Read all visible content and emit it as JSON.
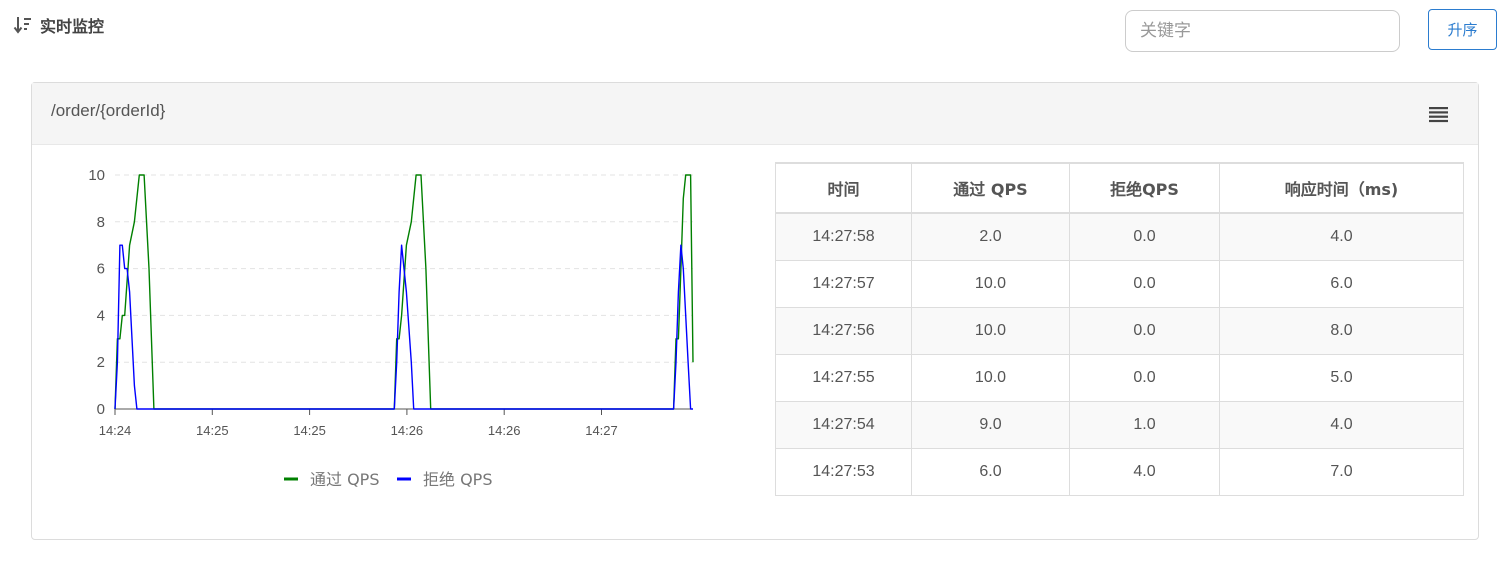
{
  "header": {
    "title": "实时监控",
    "search_placeholder": "关键字",
    "search_value": "",
    "sort_label": "升序"
  },
  "panel": {
    "resource": "/order/{orderId}",
    "menu_icon": "menu-icon"
  },
  "colors": {
    "accent": "#2b7ccf",
    "pass_series": "#008000",
    "block_series": "#0000ff"
  },
  "chart_data": {
    "type": "line",
    "title": "",
    "xlabel": "",
    "ylabel": "",
    "ylim": [
      0,
      10
    ],
    "y_ticks": [
      0,
      2,
      4,
      6,
      8,
      10
    ],
    "x_tick_labels": [
      "14:24",
      "14:25",
      "14:25",
      "14:26",
      "14:26",
      "14:27"
    ],
    "x_range": [
      "14:24:00",
      "14:27:58"
    ],
    "grid": "horizontal-dashed",
    "legend_placement": "bottom-center",
    "series": [
      {
        "name": "通过 QPS",
        "color": "#008000",
        "points": [
          [
            "14:24:00",
            0
          ],
          [
            "14:24:01",
            3
          ],
          [
            "14:24:02",
            3
          ],
          [
            "14:24:03",
            4
          ],
          [
            "14:24:04",
            4
          ],
          [
            "14:24:06",
            7
          ],
          [
            "14:24:08",
            8
          ],
          [
            "14:24:10",
            10
          ],
          [
            "14:24:12",
            10
          ],
          [
            "14:24:14",
            6
          ],
          [
            "14:24:16",
            0
          ],
          [
            "14:25:55",
            0
          ],
          [
            "14:25:56",
            3
          ],
          [
            "14:25:57",
            3
          ],
          [
            "14:25:58",
            4
          ],
          [
            "14:26:00",
            7
          ],
          [
            "14:26:02",
            8
          ],
          [
            "14:26:04",
            10
          ],
          [
            "14:26:06",
            10
          ],
          [
            "14:26:08",
            6
          ],
          [
            "14:26:10",
            0
          ],
          [
            "14:27:50",
            0
          ],
          [
            "14:27:51",
            3
          ],
          [
            "14:27:52",
            3
          ],
          [
            "14:27:53",
            6
          ],
          [
            "14:27:54",
            9
          ],
          [
            "14:27:55",
            10
          ],
          [
            "14:27:56",
            10
          ],
          [
            "14:27:57",
            10
          ],
          [
            "14:27:58",
            2
          ]
        ]
      },
      {
        "name": "拒绝 QPS",
        "color": "#0000ff",
        "points": [
          [
            "14:24:00",
            0
          ],
          [
            "14:24:01",
            2
          ],
          [
            "14:24:02",
            7
          ],
          [
            "14:24:03",
            7
          ],
          [
            "14:24:04",
            6
          ],
          [
            "14:24:05",
            6
          ],
          [
            "14:24:06",
            5
          ],
          [
            "14:24:07",
            3
          ],
          [
            "14:24:08",
            1
          ],
          [
            "14:24:09",
            0
          ],
          [
            "14:25:55",
            0
          ],
          [
            "14:25:56",
            2
          ],
          [
            "14:25:57",
            5
          ],
          [
            "14:25:58",
            7
          ],
          [
            "14:26:00",
            5
          ],
          [
            "14:26:02",
            2
          ],
          [
            "14:26:03",
            0
          ],
          [
            "14:27:50",
            0
          ],
          [
            "14:27:51",
            2
          ],
          [
            "14:27:52",
            5
          ],
          [
            "14:27:53",
            7
          ],
          [
            "14:27:54",
            6
          ],
          [
            "14:27:55",
            4
          ],
          [
            "14:27:56",
            2
          ],
          [
            "14:27:57",
            0
          ],
          [
            "14:27:58",
            0
          ]
        ]
      }
    ]
  },
  "table": {
    "columns": [
      "时间",
      "通过 QPS",
      "拒绝QPS",
      "响应时间（ms)"
    ],
    "rows": [
      [
        "14:27:58",
        "2.0",
        "0.0",
        "4.0"
      ],
      [
        "14:27:57",
        "10.0",
        "0.0",
        "6.0"
      ],
      [
        "14:27:56",
        "10.0",
        "0.0",
        "8.0"
      ],
      [
        "14:27:55",
        "10.0",
        "0.0",
        "5.0"
      ],
      [
        "14:27:54",
        "9.0",
        "1.0",
        "4.0"
      ],
      [
        "14:27:53",
        "6.0",
        "4.0",
        "7.0"
      ]
    ]
  }
}
